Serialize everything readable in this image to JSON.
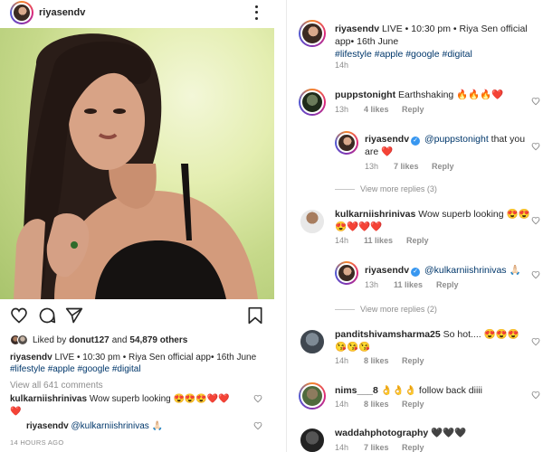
{
  "post": {
    "username": "riyasendv",
    "likes_prefix": "Liked by",
    "liked_by_user": "donut127",
    "likes_and": "and",
    "likes_others": "54,879 others",
    "caption_user": "riyasendv",
    "caption_text": "LIVE • 10:30 pm • Riya Sen official app• 16th June",
    "hashtags": [
      "#lifestyle",
      "#apple",
      "#google",
      "#digital"
    ],
    "view_all_comments": "View all 641 comments",
    "comment1_user": "kulkarniishrinivas",
    "comment1_text": "Wow superb looking 😍😍😍❤️❤️",
    "comment1_text_wrap": "❤️",
    "comment2_user": "riyasendv",
    "comment2_mention": "@kulkarniishrinivas",
    "comment2_emoji": "🙏🏻",
    "time_ago": "14 HOURS AGO"
  },
  "comments_panel": {
    "caption": {
      "user": "riyasendv",
      "text_line1": "LIVE • 10:30 pm • Riya Sen official",
      "text_line2": "app• 16th June",
      "hashtags": "#lifestyle #apple #google #digital",
      "time": "14h"
    },
    "comments": [
      {
        "user": "puppstonight",
        "text": "Earthshaking 🔥🔥🔥❤️",
        "time": "13h",
        "likes": "4 likes",
        "reply": "Reply"
      },
      {
        "user": "riyasendv",
        "mention": "@puppstonight",
        "text": "that you",
        "text2": "are ❤️",
        "time": "13h",
        "likes": "7 likes",
        "reply": "Reply",
        "verified": "✓"
      },
      {
        "user": "kulkarniishrinivas",
        "text": "Wow superb looking 😍😍",
        "text2": "😍❤️❤️❤️",
        "time": "14h",
        "likes": "11 likes",
        "reply": "Reply"
      },
      {
        "user": "riyasendv",
        "mention": "@kulkarniishrinivas",
        "text": "🙏🏻",
        "time": "13h",
        "likes": "11 likes",
        "reply": "Reply",
        "verified": "✓"
      },
      {
        "user": "panditshivamsharma25",
        "text": "So hot.... 😍😍😍",
        "text2": "😘😘😘",
        "time": "14h",
        "likes": "8 likes",
        "reply": "Reply"
      },
      {
        "user": "nims___8",
        "text": "👌👌👌 follow back diiii",
        "time": "14h",
        "likes": "8 likes",
        "reply": "Reply"
      },
      {
        "user": "waddahphotography",
        "text": "🖤🖤🖤",
        "time": "14h",
        "likes": "7 likes",
        "reply": "Reply"
      }
    ],
    "view_more_1": "View more replies (3)",
    "view_more_2": "View more replies (2)"
  },
  "colors": {
    "link": "#00376b",
    "muted": "#8e8e8e",
    "text": "#262626",
    "verified": "#3897f0"
  },
  "icons": [
    "more-options-icon",
    "like-icon",
    "comment-icon",
    "share-icon",
    "save-icon",
    "small-heart-icon",
    "verified-icon"
  ]
}
